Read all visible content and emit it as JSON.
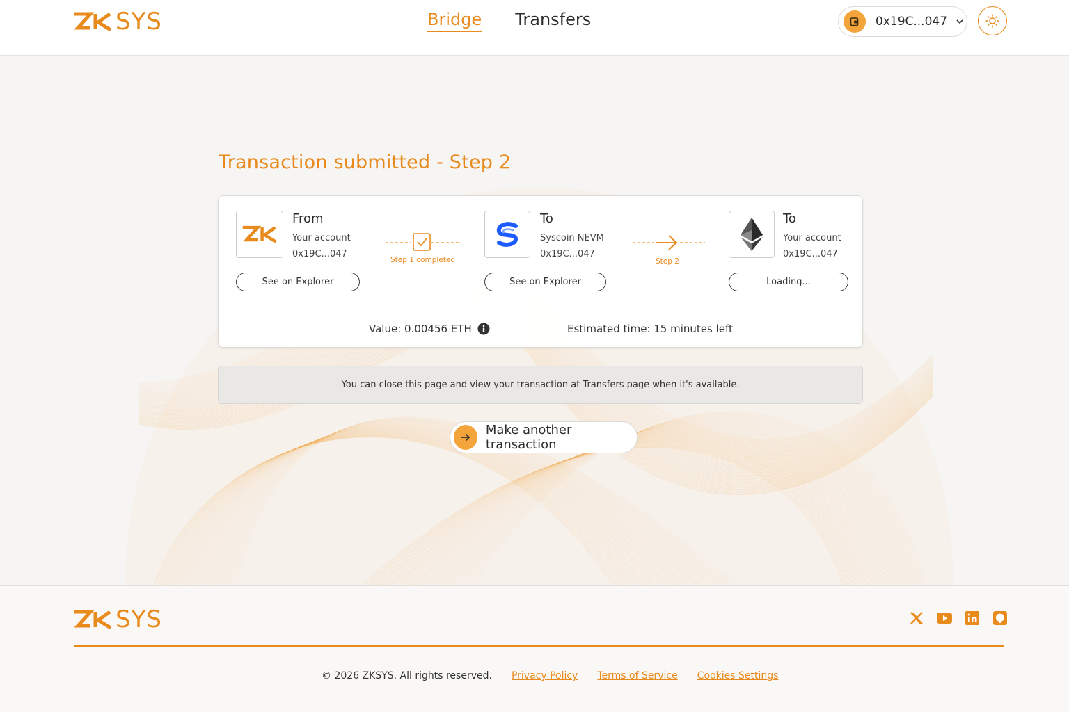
{
  "header": {
    "logo_text": "SYS",
    "nav": [
      {
        "label": "Bridge",
        "active": true
      },
      {
        "label": "Transfers",
        "active": false
      }
    ],
    "wallet_address": "0x19C...047",
    "wallet_icon": "wallet-icon",
    "theme_icon": "sun-icon"
  },
  "main": {
    "title": "Transaction submitted - Step 2",
    "from": {
      "heading": "From",
      "account_label": "Your account",
      "address": "0x19C...047",
      "button": "See on Explorer",
      "icon": "zk-logo-icon"
    },
    "step1": {
      "label": "Step 1 completed",
      "icon": "checkbox-icon"
    },
    "middle": {
      "heading": "To",
      "network": "Syscoin NEVM",
      "address": "0x19C...047",
      "button": "See on Explorer",
      "icon": "syscoin-logo-icon"
    },
    "step2": {
      "label": "Step 2",
      "icon": "arrow-right-icon"
    },
    "to": {
      "heading": "To",
      "account_label": "Your account",
      "address": "0x19C...047",
      "button": "Loading...",
      "icon": "ethereum-logo-icon"
    },
    "value": "Value: 0.00456 ETH",
    "estimated_time": "Estimated time: 15 minutes left",
    "notice": "You can close this page and view your transaction at Transfers page when it's available.",
    "cta_label": "Make another transaction"
  },
  "footer": {
    "logo_text": "SYS",
    "socials": [
      "x-icon",
      "youtube-icon",
      "linkedin-icon",
      "github-icon"
    ],
    "copyright": "© 2026 ZKSYS. All rights reserved.",
    "links": [
      "Privacy Policy",
      "Terms of Service",
      "Cookies Settings"
    ]
  },
  "colors": {
    "accent": "#e98a1c",
    "accent_light": "#f3a43a",
    "syscoin_blue": "#1e5bff"
  }
}
